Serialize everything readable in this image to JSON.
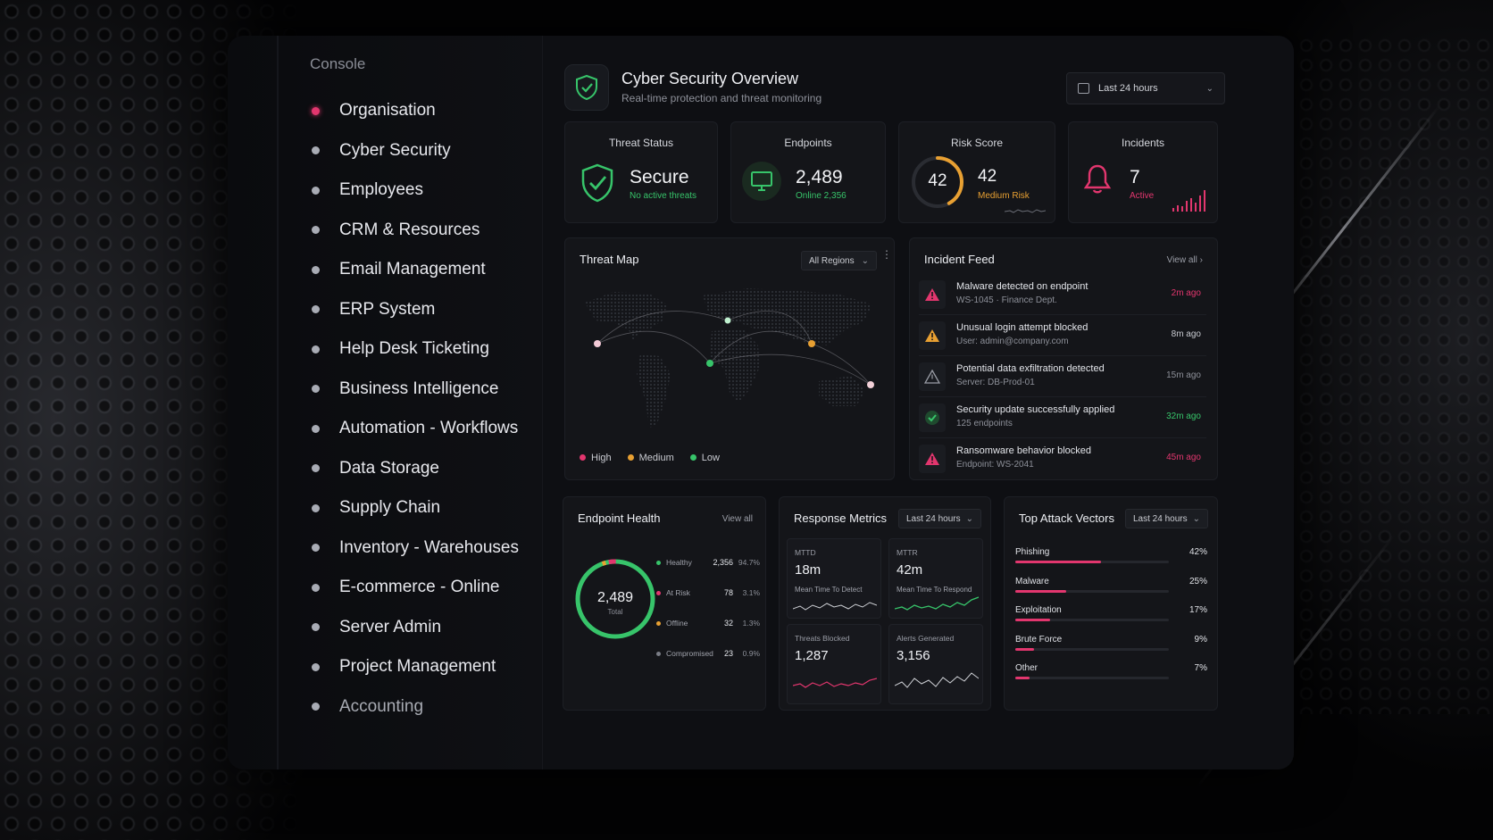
{
  "colors": {
    "accent_pink": "#e2366e",
    "accent_green": "#37c46a",
    "accent_orange": "#e8a032",
    "background": "#0e0f13",
    "card": "#141519"
  },
  "sidebar": {
    "heading": "Console",
    "items": [
      {
        "label": "Organisation"
      },
      {
        "label": "Cyber Security"
      },
      {
        "label": "Employees"
      },
      {
        "label": "CRM & Resources"
      },
      {
        "label": "Email Management"
      },
      {
        "label": "ERP System"
      },
      {
        "label": "Help Desk Ticketing"
      },
      {
        "label": "Business Intelligence"
      },
      {
        "label": "Automation - Workflows"
      },
      {
        "label": "Data Storage"
      },
      {
        "label": "Supply Chain"
      },
      {
        "label": "Inventory - Warehouses"
      },
      {
        "label": "E-commerce - Online"
      },
      {
        "label": "Server Admin"
      },
      {
        "label": "Project Management"
      },
      {
        "label": "Accounting"
      }
    ]
  },
  "header": {
    "title": "Cyber Security Overview",
    "subtitle": "Real-time protection and threat monitoring",
    "range": "Last 24 hours"
  },
  "stats": {
    "threat": {
      "label": "Threat Status",
      "value": "Secure",
      "sub": "No active threats"
    },
    "endpoints": {
      "label": "Endpoints",
      "value": "2,489",
      "sub": "Online 2,356"
    },
    "risk": {
      "label": "Risk Score",
      "gauge": "42",
      "value": "42",
      "sub": "Medium Risk",
      "score": 42,
      "max": 100
    },
    "incidents": {
      "label": "Incidents",
      "value": "7",
      "sub": "Active"
    }
  },
  "threat_map": {
    "title": "Threat Map",
    "filter": "All Regions",
    "legend": {
      "high": "High",
      "medium": "Medium",
      "low": "Low"
    }
  },
  "incident_feed": {
    "title": "Incident Feed",
    "view_all": "View all",
    "items": [
      {
        "title": "Malware detected on endpoint",
        "sub": "WS-1045 · Finance Dept.",
        "time": "2m ago",
        "severity": "high",
        "icon": "alert-triangle-icon"
      },
      {
        "title": "Unusual login attempt blocked",
        "sub": "User: admin@company.com",
        "time": "8m ago",
        "severity": "medium",
        "icon": "alert-triangle-icon"
      },
      {
        "title": "Potential data exfiltration detected",
        "sub": "Server: DB-Prod-01",
        "time": "15m ago",
        "severity": "low",
        "icon": "warning-outline-icon"
      },
      {
        "title": "Security update successfully applied",
        "sub": "125 endpoints",
        "time": "32m ago",
        "severity": "ok",
        "icon": "shield-check-icon"
      },
      {
        "title": "Ransomware behavior blocked",
        "sub": "Endpoint: WS-2041",
        "time": "45m ago",
        "severity": "high",
        "icon": "alert-triangle-icon"
      }
    ]
  },
  "endpoint_health": {
    "title": "Endpoint Health",
    "view_all": "View all",
    "total": "2,489",
    "total_label": "Total",
    "rows": [
      {
        "label": "Healthy",
        "count": "2,356",
        "pct": "94.7%",
        "color": "#37c46a"
      },
      {
        "label": "At Risk",
        "count": "78",
        "pct": "3.1%",
        "color": "#e2366e"
      },
      {
        "label": "Offline",
        "count": "32",
        "pct": "1.3%",
        "color": "#e8a032"
      },
      {
        "label": "Compromised",
        "count": "23",
        "pct": "0.9%",
        "color": "#7a7d86"
      }
    ]
  },
  "response_metrics": {
    "title": "Response Metrics",
    "range": "Last 24 hours",
    "cards": [
      {
        "key": "MTTD",
        "value": "18m",
        "desc": "Mean Time To Detect",
        "color": "#e2366e"
      },
      {
        "key": "MTTR",
        "value": "42m",
        "desc": "Mean Time To Respond",
        "color": "#37c46a"
      },
      {
        "key": "Threats Blocked",
        "value": "1,287",
        "desc": "",
        "color": "#e2366e"
      },
      {
        "key": "Alerts Generated",
        "value": "3,156",
        "desc": "",
        "color": "#cfd1d6"
      }
    ]
  },
  "attack_vectors": {
    "title": "Top Attack Vectors",
    "range": "Last 24 hours",
    "items": [
      {
        "name": "Phishing",
        "pct": "42%",
        "value": 42
      },
      {
        "name": "Malware",
        "pct": "25%",
        "value": 25
      },
      {
        "name": "Exploitation",
        "pct": "17%",
        "value": 17
      },
      {
        "name": "Brute Force",
        "pct": "9%",
        "value": 9
      },
      {
        "name": "Other",
        "pct": "7%",
        "value": 7
      }
    ]
  }
}
